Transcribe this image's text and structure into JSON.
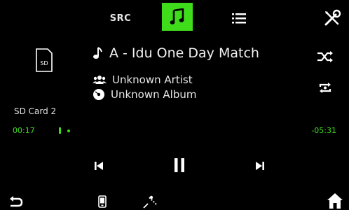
{
  "top_bar": {
    "source_label": "SRC"
  },
  "source": {
    "icon_label": "SD",
    "name": "SD Card 2"
  },
  "track": {
    "title": "A - Idu One Day Match",
    "artist": "Unknown Artist",
    "album": "Unknown Album"
  },
  "progress": {
    "elapsed": "00:17",
    "remaining": "-05:31",
    "fraction": 0.05
  },
  "colors": {
    "accent": "#3fdc1c",
    "background": "#000000",
    "text": "#ffffff"
  },
  "icons": {
    "music_tab": "music-note-icon",
    "list": "list-icon",
    "tools": "tools-icon",
    "sd_card": "sd-card-icon",
    "shuffle": "shuffle-icon",
    "repeat": "repeat-icon",
    "artist": "artist-icon",
    "album": "album-icon",
    "prev": "skip-previous-icon",
    "pause": "pause-icon",
    "next": "skip-next-icon",
    "back": "back-icon",
    "phone": "phone-icon",
    "navigation": "navigation-icon",
    "home": "home-icon"
  }
}
